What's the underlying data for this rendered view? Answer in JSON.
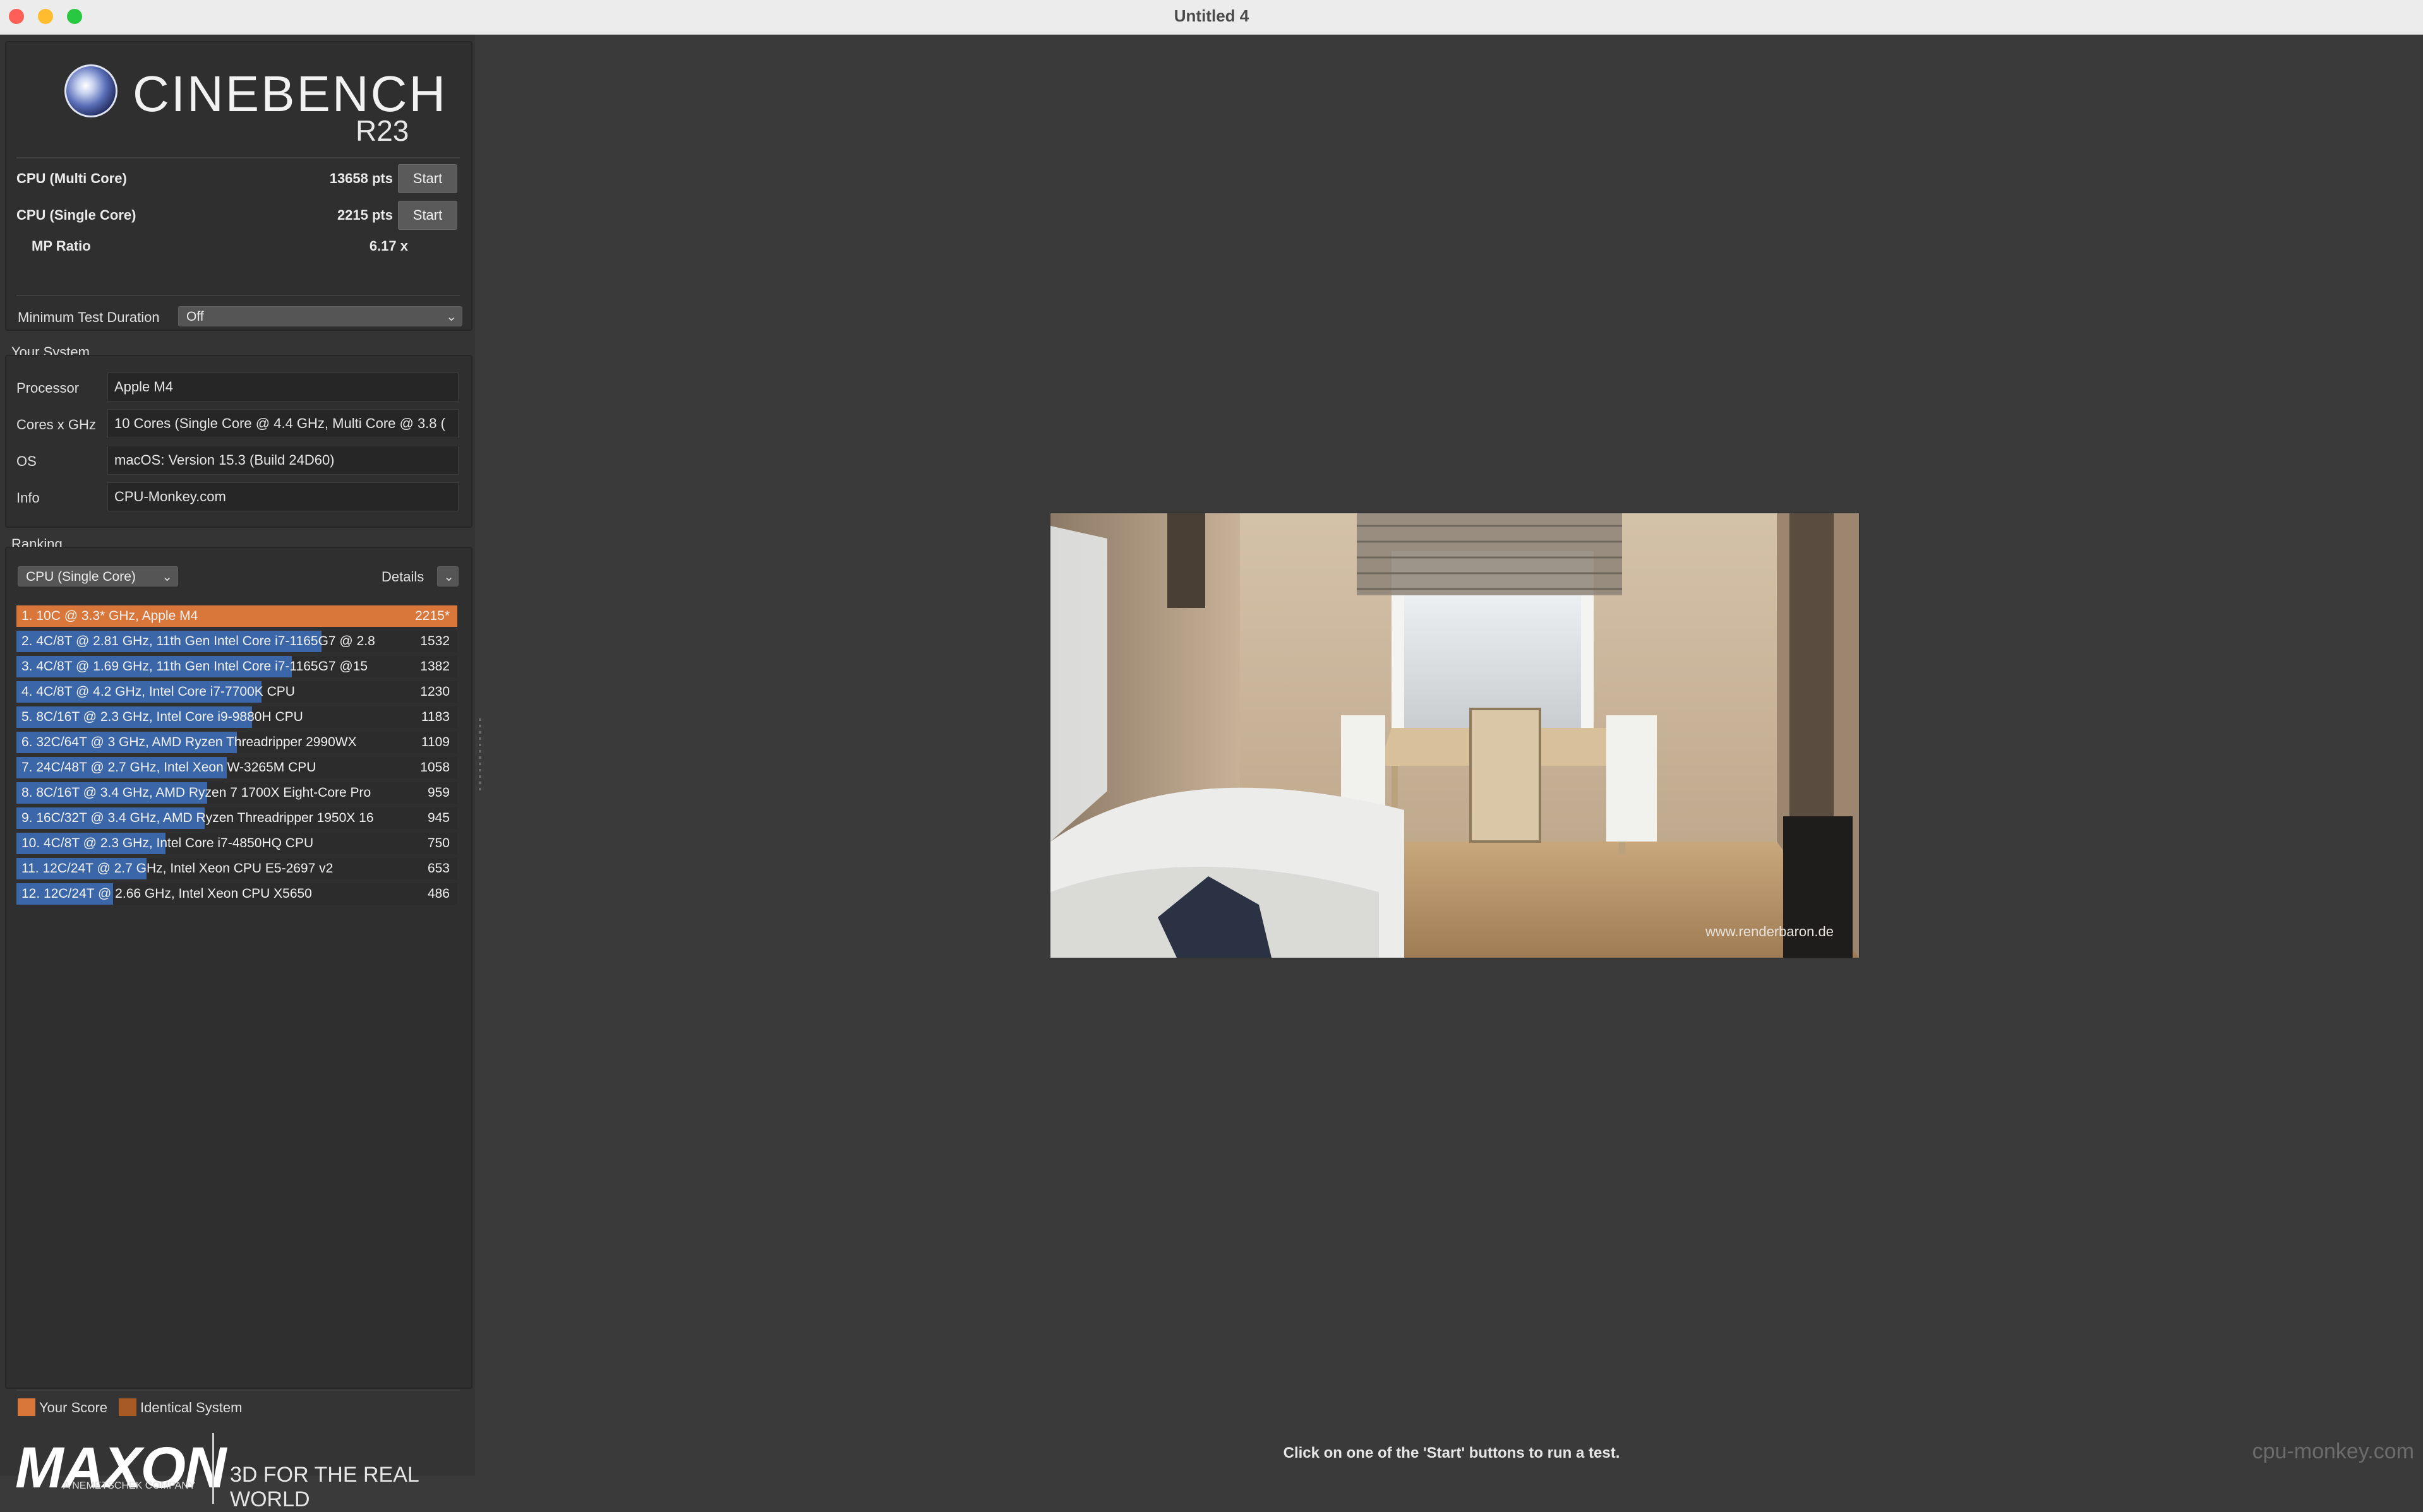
{
  "window": {
    "title": "Untitled 4"
  },
  "logo": {
    "name": "CINEBENCH",
    "version": "R23"
  },
  "tests": {
    "multi": {
      "label": "CPU (Multi Core)",
      "score": "13658 pts",
      "button": "Start"
    },
    "single": {
      "label": "CPU (Single Core)",
      "score": "2215 pts",
      "button": "Start"
    },
    "mp_ratio": {
      "label": "MP Ratio",
      "value": "6.17 x"
    }
  },
  "duration": {
    "label": "Minimum Test Duration",
    "value": "Off"
  },
  "system": {
    "title": "Your System",
    "fields": [
      {
        "label": "Processor",
        "value": "Apple M4"
      },
      {
        "label": "Cores x GHz",
        "value": "10 Cores (Single Core @ 4.4 GHz, Multi Core @ 3.8 ("
      },
      {
        "label": "OS",
        "value": "macOS: Version 15.3 (Build 24D60)"
      },
      {
        "label": "Info",
        "value": "CPU-Monkey.com"
      }
    ]
  },
  "ranking": {
    "title": "Ranking",
    "selected": "CPU (Single Core)",
    "details_label": "Details",
    "max_score": 2215,
    "entries": [
      {
        "text": "1. 10C @ 3.3* GHz, Apple M4",
        "score": "2215*",
        "value": 2215,
        "mine": true
      },
      {
        "text": "2. 4C/8T @ 2.81 GHz, 11th Gen Intel Core i7-1165G7 @ 2.8",
        "score": "1532",
        "value": 1532,
        "mine": false
      },
      {
        "text": "3. 4C/8T @ 1.69 GHz, 11th Gen Intel Core i7-1165G7 @15",
        "score": "1382",
        "value": 1382,
        "mine": false
      },
      {
        "text": "4. 4C/8T @ 4.2 GHz, Intel Core i7-7700K CPU",
        "score": "1230",
        "value": 1230,
        "mine": false
      },
      {
        "text": "5. 8C/16T @ 2.3 GHz, Intel Core i9-9880H CPU",
        "score": "1183",
        "value": 1183,
        "mine": false
      },
      {
        "text": "6. 32C/64T @ 3 GHz, AMD Ryzen Threadripper 2990WX",
        "score": "1109",
        "value": 1109,
        "mine": false
      },
      {
        "text": "7. 24C/48T @ 2.7 GHz, Intel Xeon W-3265M CPU",
        "score": "1058",
        "value": 1058,
        "mine": false
      },
      {
        "text": "8. 8C/16T @ 3.4 GHz, AMD Ryzen 7 1700X Eight-Core Pro",
        "score": "959",
        "value": 959,
        "mine": false
      },
      {
        "text": "9. 16C/32T @ 3.4 GHz, AMD Ryzen Threadripper 1950X 16",
        "score": "945",
        "value": 945,
        "mine": false
      },
      {
        "text": "10. 4C/8T @ 2.3 GHz, Intel Core i7-4850HQ CPU",
        "score": "750",
        "value": 750,
        "mine": false
      },
      {
        "text": "11. 12C/24T @ 2.7 GHz, Intel Xeon CPU E5-2697 v2",
        "score": "653",
        "value": 653,
        "mine": false
      },
      {
        "text": "12. 12C/24T @ 2.66 GHz, Intel Xeon CPU X5650",
        "score": "486",
        "value": 486,
        "mine": false
      }
    ]
  },
  "legend": {
    "your_score": "Your Score",
    "identical": "Identical System",
    "your_color": "#d9773a",
    "identical_color": "#a85a24"
  },
  "maxon": {
    "brand": "MAXON",
    "sub": "A NEMETSCHEK COMPANY",
    "tagline": "3D FOR THE REAL WORLD"
  },
  "render": {
    "watermark": "www.renderbaron.de"
  },
  "status": {
    "message": "Click on one of the 'Start' buttons to run a test."
  },
  "site_watermark": "cpu-monkey.com",
  "colors": {
    "accent_bar": "#3b67a8",
    "your_bar": "#d9773a",
    "background": "#3a3a3a"
  }
}
